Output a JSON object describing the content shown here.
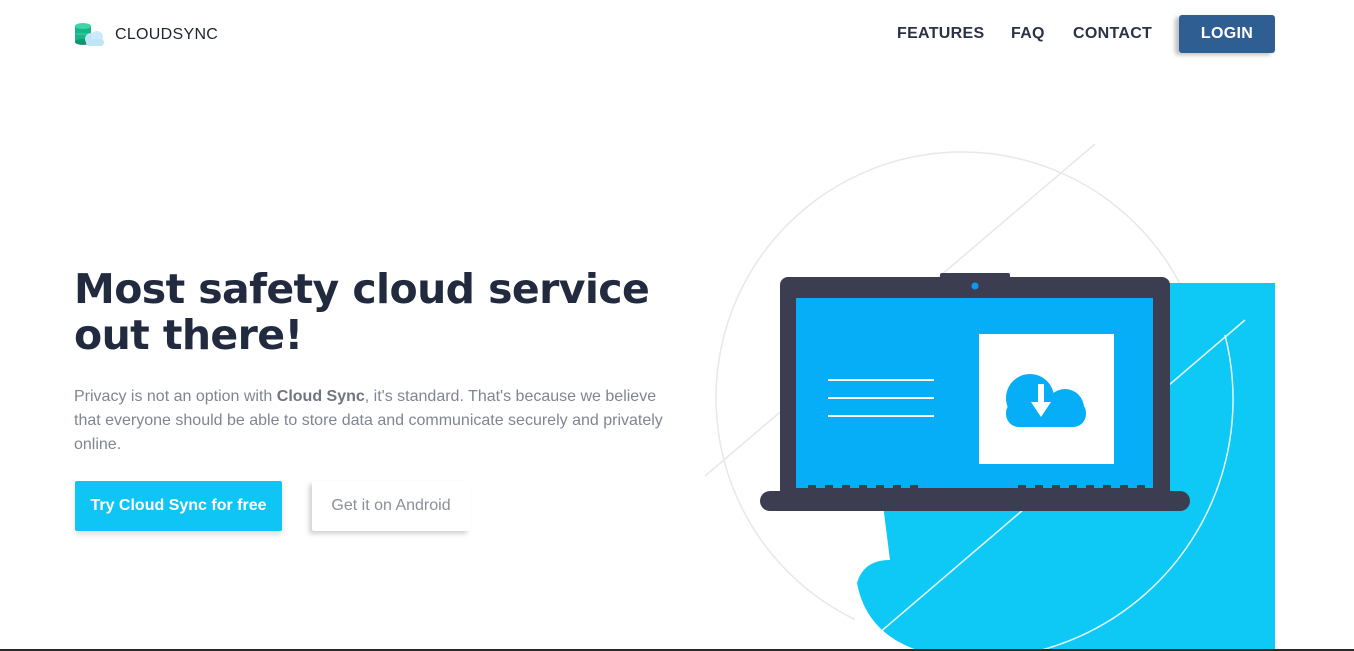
{
  "brand": {
    "name": "CLOUDSYNC",
    "icon": "database-cloud-icon"
  },
  "nav": {
    "items": [
      {
        "label": "FEATURES"
      },
      {
        "label": "FAQ"
      },
      {
        "label": "CONTACT"
      }
    ],
    "login_label": "LOGIN"
  },
  "hero": {
    "title": "Most safety cloud service out there!",
    "text_before": "Privacy is not an option with ",
    "text_bold": "Cloud Sync",
    "text_after": ", it's standard. That's because we believe that everyone should be able to store data and communicate securely and privately online.",
    "primary_cta": "Try Cloud Sync for free",
    "secondary_cta": "Get it on Android"
  },
  "illustration": {
    "icon": "cloud-download-icon",
    "device": "laptop-icon"
  },
  "colors": {
    "accent": "#0fc5f5",
    "login": "#2f5f92",
    "dark": "#222a3f",
    "screen": "#05aef7",
    "laptop": "#3d3d52"
  }
}
